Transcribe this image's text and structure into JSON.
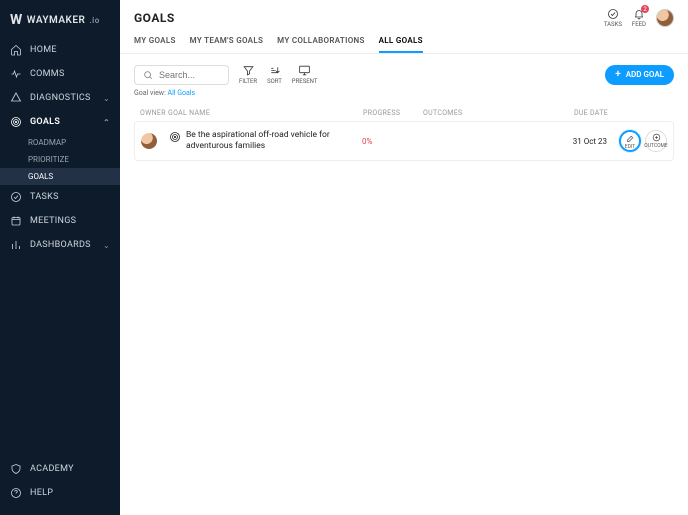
{
  "brand": {
    "name": "WAYMAKER",
    "suffix": ".io"
  },
  "sidebar": {
    "items": [
      {
        "label": "HOME",
        "icon": "home"
      },
      {
        "label": "COMMS",
        "icon": "pulse"
      },
      {
        "label": "DIAGNOSTICS",
        "icon": "diag",
        "chev": "down"
      },
      {
        "label": "GOALS",
        "icon": "target",
        "chev": "up",
        "children": [
          {
            "label": "ROADMAP"
          },
          {
            "label": "PRIORITIZE"
          },
          {
            "label": "GOALS",
            "selected": true
          }
        ]
      },
      {
        "label": "TASKS",
        "icon": "check"
      },
      {
        "label": "MEETINGS",
        "icon": "calendar"
      },
      {
        "label": "DASHBOARDS",
        "icon": "bars",
        "chev": "down"
      }
    ],
    "bottom": [
      {
        "label": "ACADEMY",
        "icon": "shield"
      },
      {
        "label": "HELP",
        "icon": "help"
      }
    ]
  },
  "header": {
    "title": "GOALS",
    "right": [
      {
        "label": "TASKS",
        "icon": "check"
      },
      {
        "label": "FEED",
        "icon": "bell",
        "badge": "2"
      }
    ]
  },
  "tabs": [
    {
      "label": "MY GOALS"
    },
    {
      "label": "MY TEAM'S GOALS"
    },
    {
      "label": "MY COLLABORATIONS"
    },
    {
      "label": "ALL GOALS",
      "active": true
    }
  ],
  "toolbar": {
    "search_placeholder": "Search...",
    "filter": "FILTER",
    "sort": "SORT",
    "present": "PRESENT",
    "add": "ADD GOAL"
  },
  "view": {
    "prefix": "Goal view:",
    "name": "All Goals"
  },
  "columns": {
    "owner": "OWNER",
    "name": "GOAL NAME",
    "progress": "PROGRESS",
    "outcomes": "OUTCOMES",
    "due": "DUE DATE"
  },
  "rows": [
    {
      "name": "Be the aspirational off-road vehicle for adventurous families",
      "progress": "0%",
      "due": "31 Oct 23"
    }
  ],
  "actions": {
    "edit": "EDIT",
    "outcome": "OUTCOME"
  }
}
